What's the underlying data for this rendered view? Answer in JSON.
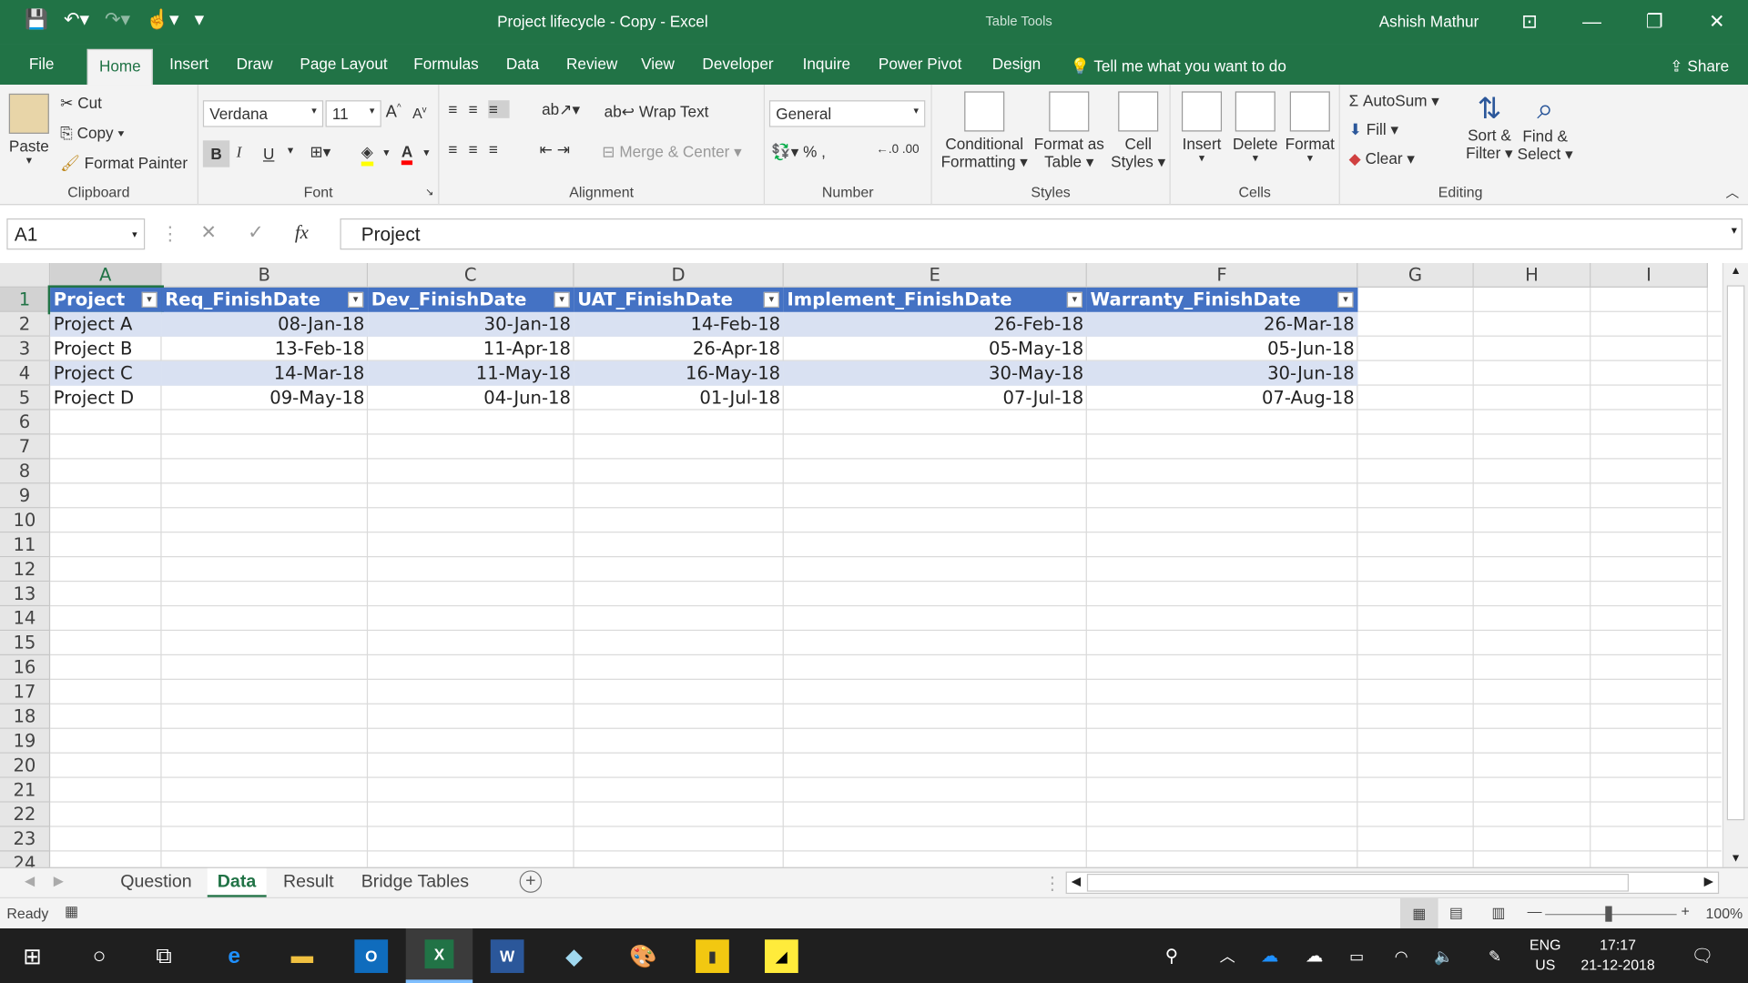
{
  "window": {
    "title": "Project lifecycle - Copy  -  Excel",
    "context_tab": "Table Tools",
    "user": "Ashish Mathur"
  },
  "tabs": [
    "File",
    "Home",
    "Insert",
    "Draw",
    "Page Layout",
    "Formulas",
    "Data",
    "Review",
    "View",
    "Developer",
    "Inquire",
    "Power Pivot",
    "Design"
  ],
  "tell_me": "Tell me what you want to do",
  "share": "Share",
  "ribbon": {
    "clipboard": {
      "paste": "Paste",
      "cut": "Cut",
      "copy": "Copy",
      "format_painter": "Format Painter",
      "label": "Clipboard"
    },
    "font": {
      "name": "Verdana",
      "size": "11",
      "bold": "B",
      "italic": "I",
      "underline": "U",
      "label": "Font"
    },
    "alignment": {
      "wrap": "Wrap Text",
      "merge": "Merge & Center",
      "label": "Alignment"
    },
    "number": {
      "format": "General",
      "label": "Number"
    },
    "styles": {
      "conditional": "Conditional",
      "conditional2": "Formatting",
      "format_as": "Format as",
      "format_as2": "Table",
      "cell_styles": "Cell",
      "cell_styles2": "Styles",
      "label": "Styles"
    },
    "cells": {
      "insert": "Insert",
      "delete": "Delete",
      "format": "Format",
      "label": "Cells"
    },
    "editing": {
      "autosum": "AutoSum",
      "fill": "Fill",
      "clear": "Clear",
      "sort": "Sort &",
      "sort2": "Filter",
      "find": "Find &",
      "find2": "Select",
      "label": "Editing"
    }
  },
  "formula_bar": {
    "name_box": "A1",
    "formula": "Project"
  },
  "columns": [
    "A",
    "B",
    "C",
    "D",
    "E",
    "F",
    "G",
    "H",
    "I"
  ],
  "rows": [
    "1",
    "2",
    "3",
    "4",
    "5",
    "6",
    "7",
    "8",
    "9",
    "10",
    "11",
    "12",
    "13",
    "14",
    "15",
    "16",
    "17",
    "18",
    "19",
    "20",
    "21",
    "22",
    "23",
    "24"
  ],
  "table": {
    "headers": [
      "Project",
      "Req_FinishDate",
      "Dev_FinishDate",
      "UAT_FinishDate",
      "Implement_FinishDate",
      "Warranty_FinishDate"
    ],
    "rows": [
      [
        "Project A",
        "08-Jan-18",
        "30-Jan-18",
        "14-Feb-18",
        "26-Feb-18",
        "26-Mar-18"
      ],
      [
        "Project B",
        "13-Feb-18",
        "11-Apr-18",
        "26-Apr-18",
        "05-May-18",
        "05-Jun-18"
      ],
      [
        "Project C",
        "14-Mar-18",
        "11-May-18",
        "16-May-18",
        "30-May-18",
        "30-Jun-18"
      ],
      [
        "Project D",
        "09-May-18",
        "04-Jun-18",
        "01-Jul-18",
        "07-Jul-18",
        "07-Aug-18"
      ]
    ]
  },
  "sheets": [
    "Question",
    "Data",
    "Result",
    "Bridge Tables"
  ],
  "active_sheet": "Data",
  "status": {
    "ready": "Ready",
    "zoom": "100%"
  },
  "taskbar": {
    "lang1": "ENG",
    "lang2": "US",
    "time": "17:17",
    "date": "21-12-2018"
  }
}
